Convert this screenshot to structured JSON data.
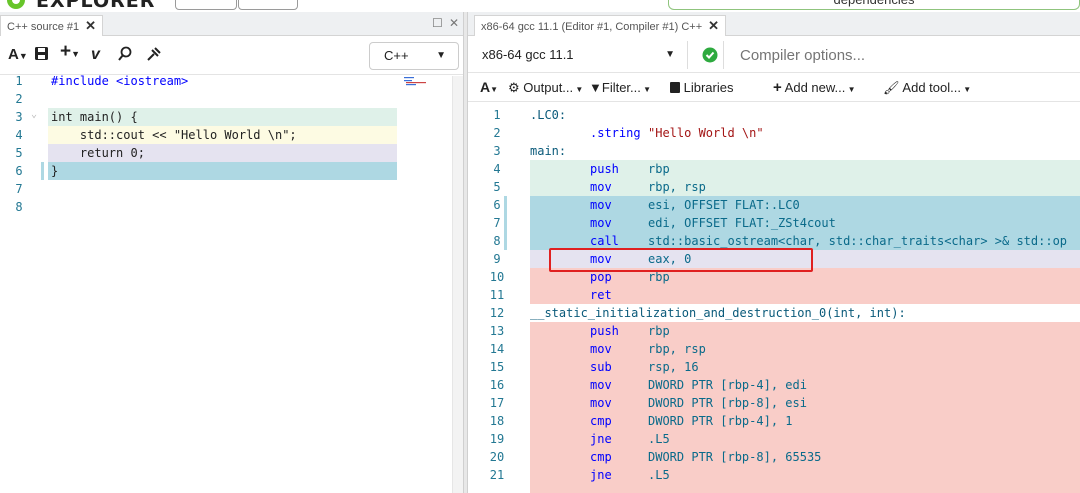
{
  "app": {
    "logo_text": "EXPLORER",
    "dependencies_label": "dependencies"
  },
  "source_pane": {
    "tab_label": "C++ source #1",
    "toolbar": {
      "font_label": "A",
      "add_label": "+",
      "language": "C++"
    },
    "lines": [
      {
        "n": "1",
        "text": "#include <iostream>"
      },
      {
        "n": "2",
        "text": ""
      },
      {
        "n": "3",
        "text": "int main() {"
      },
      {
        "n": "4",
        "text": "    std::cout << \"Hello World \\n\";"
      },
      {
        "n": "5",
        "text": "    return 0;"
      },
      {
        "n": "6",
        "text": "}"
      },
      {
        "n": "7",
        "text": ""
      },
      {
        "n": "8",
        "text": ""
      }
    ]
  },
  "compiler_pane": {
    "tab_label": "x86-64 gcc 11.1 (Editor #1, Compiler #1) C++",
    "compiler": "x86-64 gcc 11.1",
    "options_placeholder": "Compiler options...",
    "toolbar": {
      "font_label": "A",
      "output_label": "Output...",
      "filter_label": "Filter...",
      "libraries_label": "Libraries",
      "add_new_label": "Add new...",
      "add_tool_label": "Add tool..."
    },
    "lines": [
      {
        "n": "1",
        "label": ".LC0:",
        "op": "",
        "args": ""
      },
      {
        "n": "2",
        "label": "",
        "op": ".string",
        "args": "\"Hello World \\n\""
      },
      {
        "n": "3",
        "label": "main:",
        "op": "",
        "args": ""
      },
      {
        "n": "4",
        "label": "",
        "op": "push",
        "args": "rbp"
      },
      {
        "n": "5",
        "label": "",
        "op": "mov",
        "args": "rbp, rsp"
      },
      {
        "n": "6",
        "label": "",
        "op": "mov",
        "args": "esi, OFFSET FLAT:.LC0"
      },
      {
        "n": "7",
        "label": "",
        "op": "mov",
        "args": "edi, OFFSET FLAT:_ZSt4cout"
      },
      {
        "n": "8",
        "label": "",
        "op": "call",
        "args": "std::basic_ostream<char, std::char_traits<char> >& std::op"
      },
      {
        "n": "9",
        "label": "",
        "op": "mov",
        "args": "eax, 0"
      },
      {
        "n": "10",
        "label": "",
        "op": "pop",
        "args": "rbp"
      },
      {
        "n": "11",
        "label": "",
        "op": "ret",
        "args": ""
      },
      {
        "n": "12",
        "label": "__static_initialization_and_destruction_0(int, int):",
        "op": "",
        "args": ""
      },
      {
        "n": "13",
        "label": "",
        "op": "push",
        "args": "rbp"
      },
      {
        "n": "14",
        "label": "",
        "op": "mov",
        "args": "rbp, rsp"
      },
      {
        "n": "15",
        "label": "",
        "op": "sub",
        "args": "rsp, 16"
      },
      {
        "n": "16",
        "label": "",
        "op": "mov",
        "args": "DWORD PTR [rbp-4], edi"
      },
      {
        "n": "17",
        "label": "",
        "op": "mov",
        "args": "DWORD PTR [rbp-8], esi"
      },
      {
        "n": "18",
        "label": "",
        "op": "cmp",
        "args": "DWORD PTR [rbp-4], 1"
      },
      {
        "n": "19",
        "label": "",
        "op": "jne",
        "args": ".L5"
      },
      {
        "n": "20",
        "label": "",
        "op": "cmp",
        "args": "DWORD PTR [rbp-8], 65535"
      },
      {
        "n": "21",
        "label": "",
        "op": "jne",
        "args": ".L5"
      }
    ]
  },
  "colors": {
    "green_band": "#dff1e9",
    "yellow_band": "#fdfbe3",
    "purple_band": "#e5e3f0",
    "blue_band": "#aed8e3",
    "pink_band": "#f9cdc8",
    "highlight_box": "#e02020"
  }
}
